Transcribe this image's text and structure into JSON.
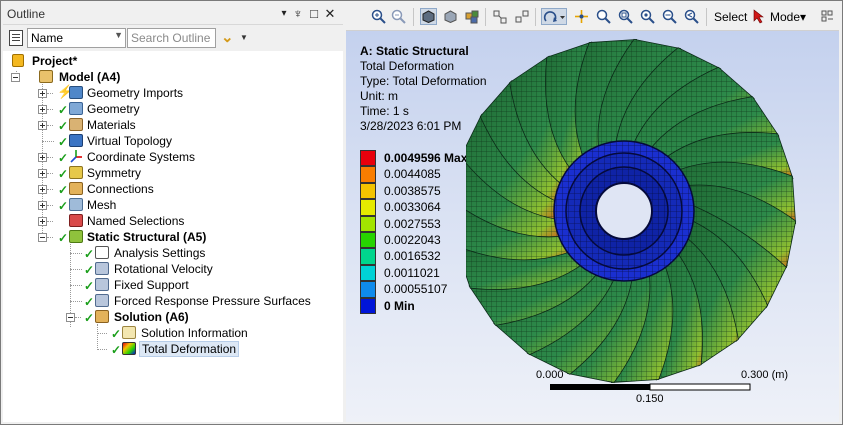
{
  "outline": {
    "title": "Outline",
    "controls": [
      "▾",
      "♆",
      "□",
      "✕"
    ],
    "filter_select": "Name",
    "search_placeholder": "Search Outline"
  },
  "tree": [
    {
      "label": "Project*",
      "bold": true
    },
    {
      "label": "Model (A4)",
      "bold": true
    },
    {
      "label": "Geometry Imports"
    },
    {
      "label": "Geometry"
    },
    {
      "label": "Materials"
    },
    {
      "label": "Virtual Topology"
    },
    {
      "label": "Coordinate Systems"
    },
    {
      "label": "Symmetry"
    },
    {
      "label": "Connections"
    },
    {
      "label": "Mesh"
    },
    {
      "label": "Named Selections"
    },
    {
      "label": "Static Structural (A5)",
      "bold": true
    },
    {
      "label": "Analysis Settings"
    },
    {
      "label": "Rotational Velocity"
    },
    {
      "label": "Fixed Support"
    },
    {
      "label": "Forced Response Pressure Surfaces"
    },
    {
      "label": "Solution (A6)",
      "bold": true
    },
    {
      "label": "Solution Information"
    },
    {
      "label": "Total Deformation",
      "selected": true
    }
  ],
  "toolbar": {
    "select_label": "Select",
    "mode_label": "Mode▾"
  },
  "result": {
    "analysis": "A: Static Structural",
    "name": "Total Deformation",
    "type_line": "Type: Total Deformation",
    "unit_line": "Unit: m",
    "time_line": "Time: 1 s",
    "date_line": "3/28/2023 6:01 PM"
  },
  "legend": [
    {
      "label": "0.0049596 Max",
      "color": "#e8000c",
      "bold": true
    },
    {
      "label": "0.0044085",
      "color": "#f97d00"
    },
    {
      "label": "0.0038575",
      "color": "#f3c300"
    },
    {
      "label": "0.0033064",
      "color": "#e6ea00"
    },
    {
      "label": "0.0027553",
      "color": "#a2e400"
    },
    {
      "label": "0.0022043",
      "color": "#27d400"
    },
    {
      "label": "0.0016532",
      "color": "#00d58d"
    },
    {
      "label": "0.0011021",
      "color": "#00d2d6"
    },
    {
      "label": "0.00055107",
      "color": "#0f8bec"
    },
    {
      "label": "0 Min",
      "color": "#0015d8",
      "bold": true
    }
  ],
  "scale": {
    "left": "0.000",
    "middle": "0.150",
    "right": "0.300 (m)"
  }
}
